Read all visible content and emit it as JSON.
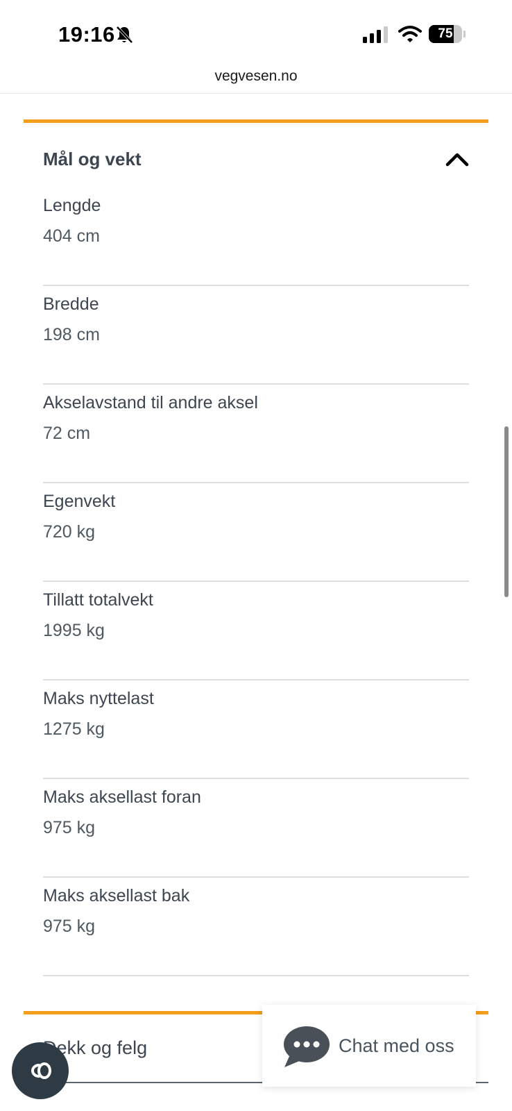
{
  "status_bar": {
    "time": "19:16",
    "battery": "75",
    "battery_level": 0.75
  },
  "browser": {
    "url": "vegvesen.no"
  },
  "section": {
    "title": "Mål og vekt",
    "expanded": true,
    "rows": [
      {
        "label": "Lengde",
        "value": "404 cm"
      },
      {
        "label": "Bredde",
        "value": "198 cm"
      },
      {
        "label": "Akselavstand til andre aksel",
        "value": "72 cm"
      },
      {
        "label": "Egenvekt",
        "value": "720 kg"
      },
      {
        "label": "Tillatt totalvekt",
        "value": "1995 kg"
      },
      {
        "label": "Maks nyttelast",
        "value": "1275 kg"
      },
      {
        "label": "Maks aksellast foran",
        "value": "975 kg"
      },
      {
        "label": "Maks aksellast bak",
        "value": "975 kg"
      }
    ]
  },
  "next_section": {
    "title": "Dekk og felg"
  },
  "chat": {
    "label": "Chat med oss"
  },
  "colors": {
    "accent": "#f29d1b",
    "text": "#3d4650",
    "cookie_button": "#2e3a44"
  },
  "icons": {
    "bell": "bell-slash-icon",
    "signal": "cellular-signal-icon",
    "wifi": "wifi-icon",
    "chevron": "chevron-up-icon",
    "chat": "chat-bubble-icon",
    "cookie": "cookie-consent-icon"
  }
}
